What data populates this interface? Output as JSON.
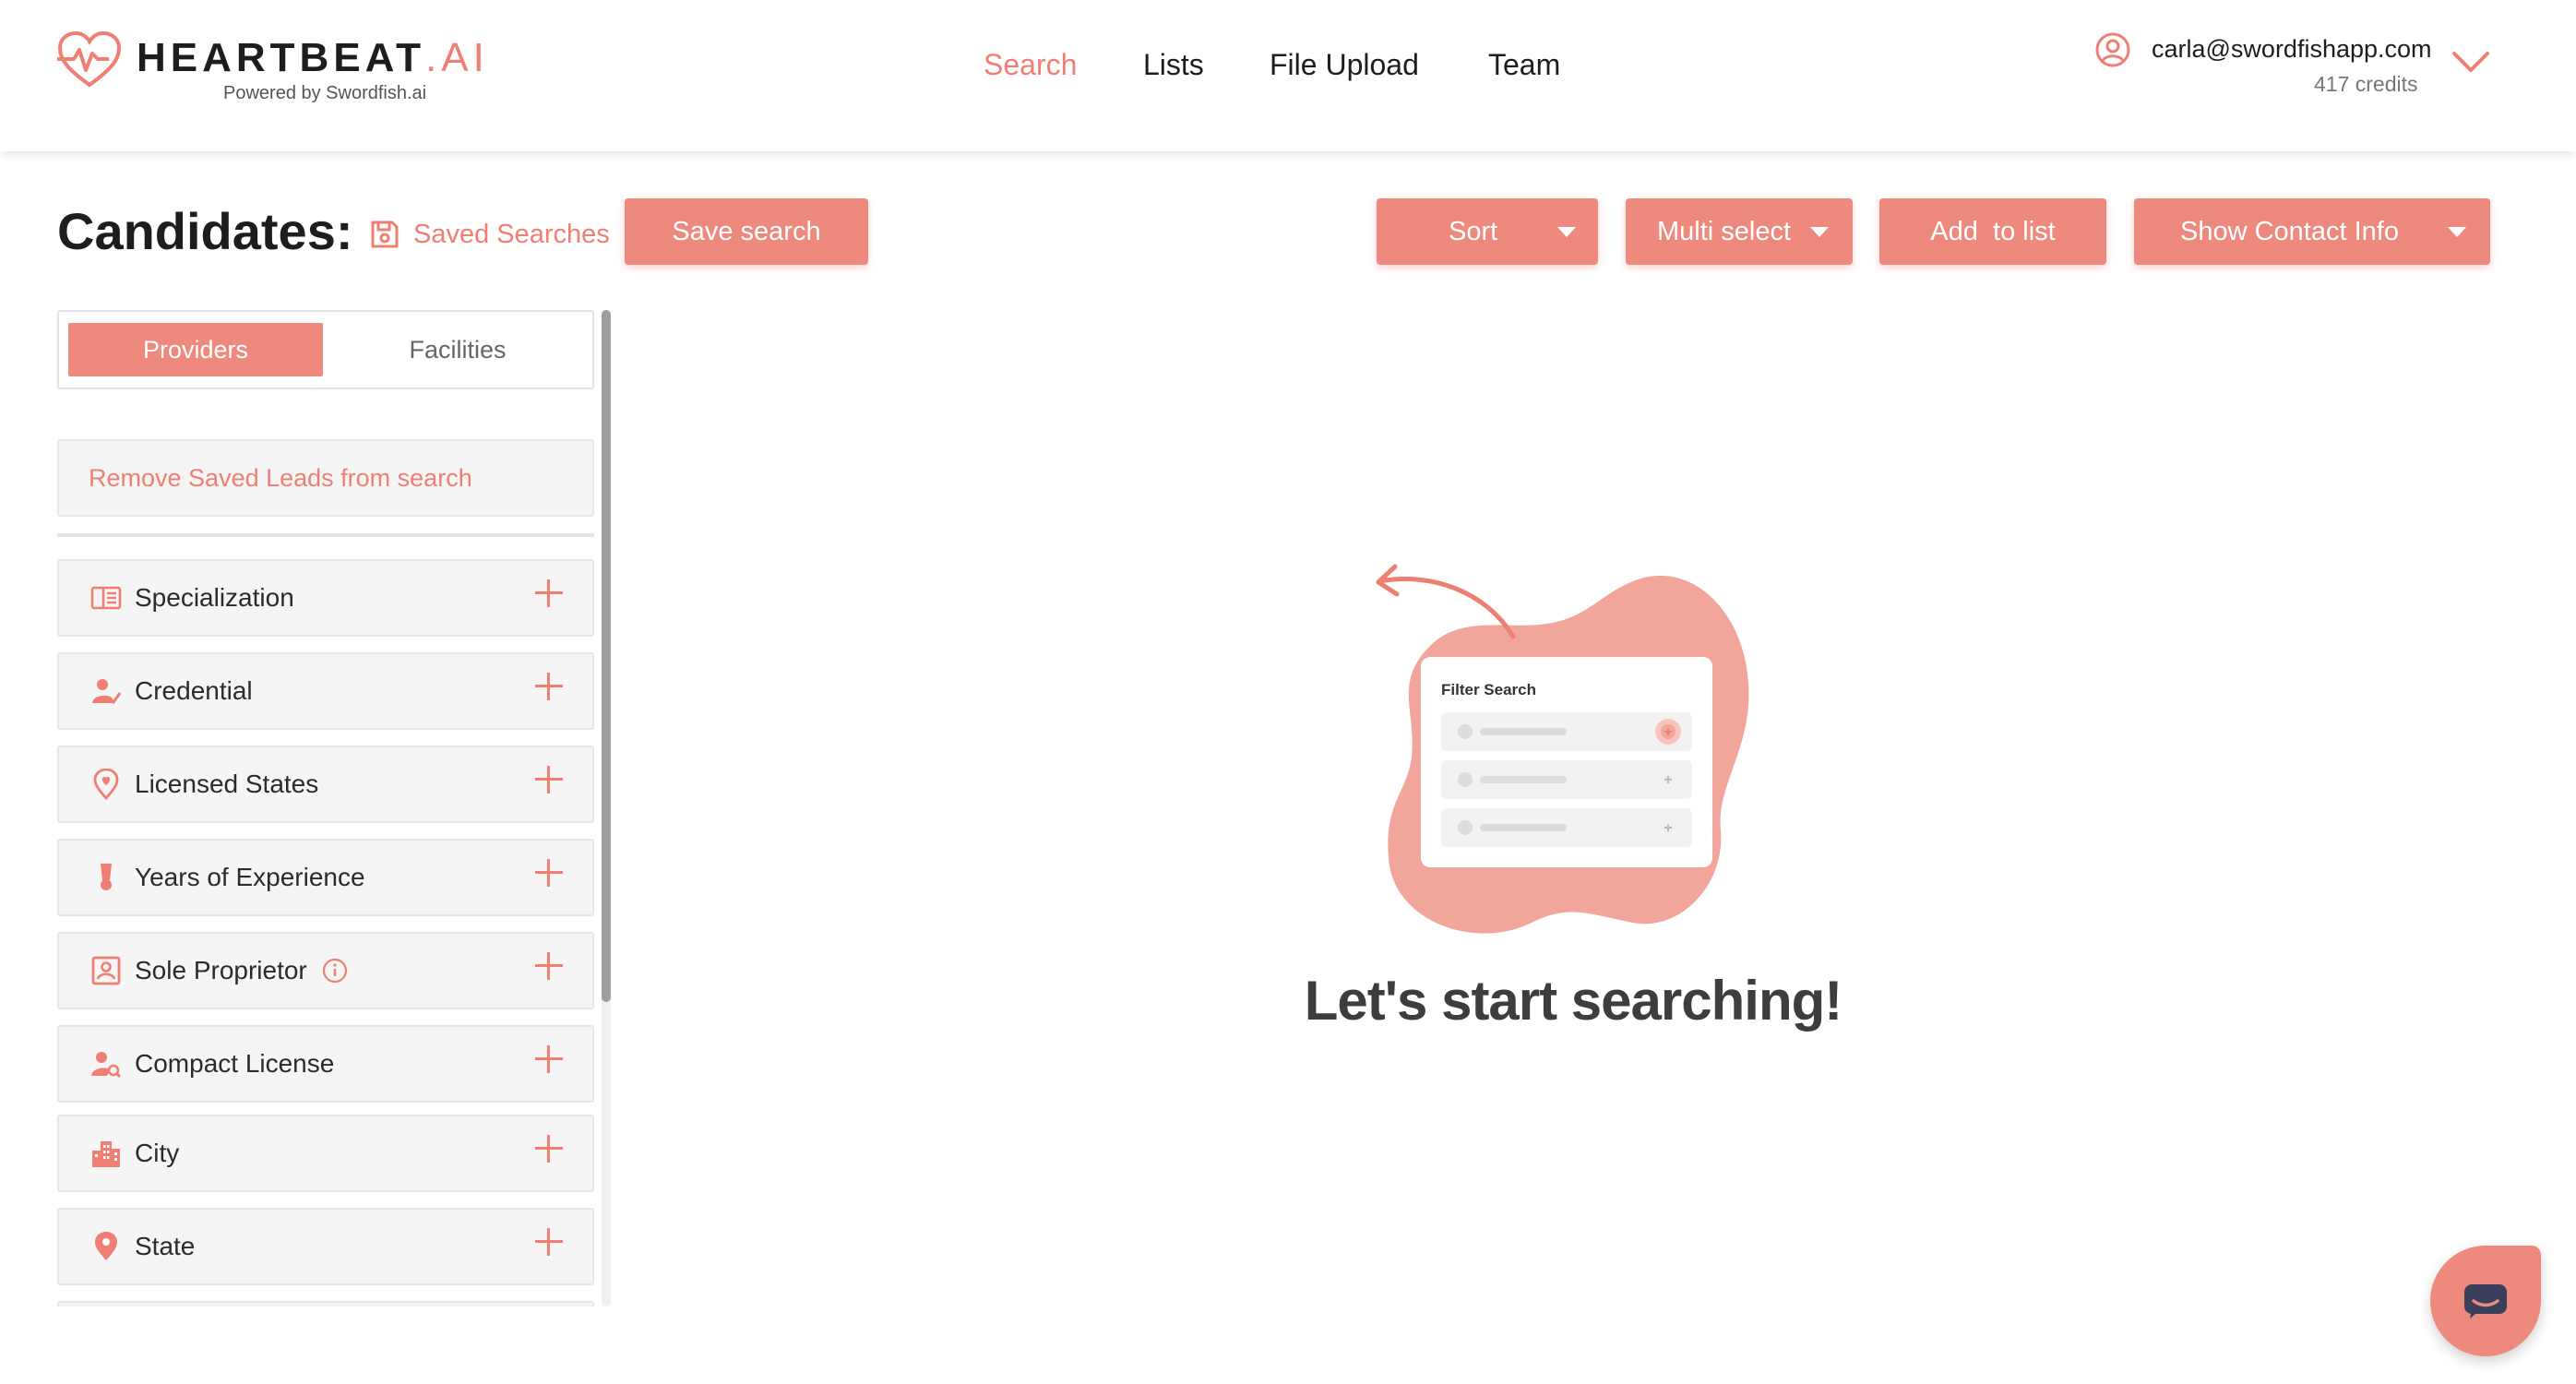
{
  "colors": {
    "accent": "#ee7f72",
    "button": "#ee8a7d",
    "text": "#1d1d1f"
  },
  "header": {
    "brand": "HEARTBEAT",
    "brand_suffix": ".AI",
    "powered_by": "Powered by Swordfish.ai",
    "nav": [
      {
        "label": "Search",
        "active": true
      },
      {
        "label": "Lists",
        "active": false
      },
      {
        "label": "File Upload",
        "active": false
      },
      {
        "label": "Team",
        "active": false
      }
    ],
    "account": {
      "email": "carla@swordfishapp.com",
      "credits": "417 credits",
      "icon": "user-circle-icon"
    }
  },
  "toolbar": {
    "title": "Candidates:",
    "saved_searches": "Saved Searches",
    "save_search": "Save search",
    "sort": "Sort",
    "multi_select": "Multi select",
    "add_to_list": "Add  to list",
    "show_contact_info": "Show Contact Info"
  },
  "sidebar": {
    "tabs": [
      {
        "label": "Providers",
        "active": true
      },
      {
        "label": "Facilities",
        "active": false
      }
    ],
    "remove_saved_leads": "Remove Saved Leads from search",
    "filters": [
      {
        "label": "Specialization",
        "icon": "specialization-icon"
      },
      {
        "label": "Credential",
        "icon": "credential-icon"
      },
      {
        "label": "Licensed States",
        "icon": "location-heart-icon"
      },
      {
        "label": "Years of Experience",
        "icon": "medal-icon"
      },
      {
        "label": "Sole Proprietor",
        "icon": "id-card-icon"
      },
      {
        "label": "Compact License",
        "icon": "user-search-icon"
      },
      {
        "label": "City",
        "icon": "city-icon"
      },
      {
        "label": "State",
        "icon": "map-pin-icon"
      }
    ]
  },
  "empty_state": {
    "card_title": "Filter Search",
    "message": "Let's start searching!"
  }
}
